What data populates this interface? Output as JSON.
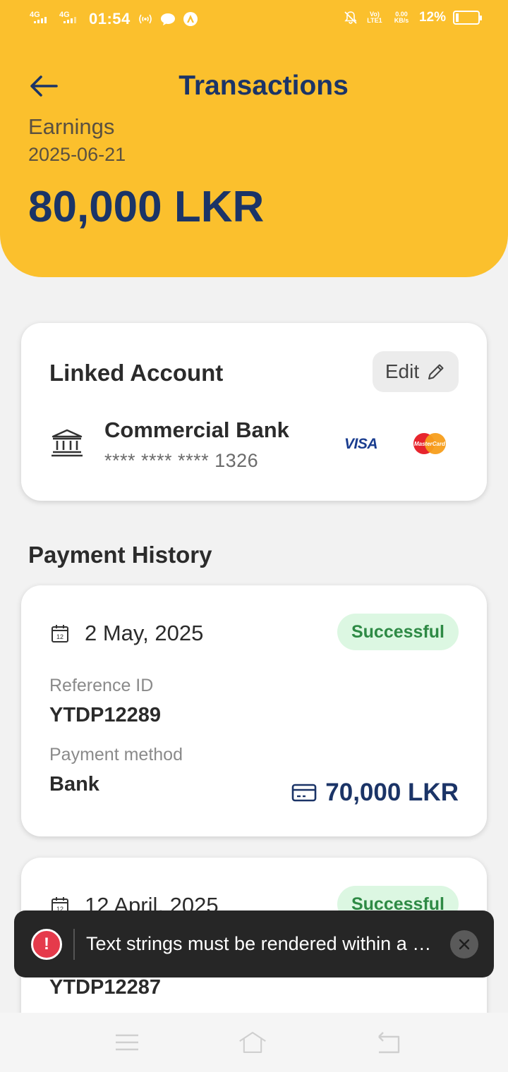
{
  "statusbar": {
    "net1": "4G",
    "net2": "4G",
    "time": "01:54",
    "volte": "Vo) LTE1",
    "speed": "0.00 KB/s",
    "battery": "12%"
  },
  "header": {
    "title": "Transactions",
    "earnings_label": "Earnings",
    "earnings_date": "2025-06-21",
    "earnings_amount": "80,000 LKR"
  },
  "linked_account": {
    "heading": "Linked Account",
    "edit_label": "Edit",
    "bank_name": "Commercial Bank",
    "card_number": "**** **** **** 1326",
    "visa_text": "VISA",
    "mastercard_text": "MasterCard"
  },
  "payment_history": {
    "title": "Payment History",
    "items": [
      {
        "date": "2 May, 2025",
        "calendar_day": "12",
        "status": "Successful",
        "ref_label": "Reference ID",
        "ref_value": "YTDP12289",
        "method_label": "Payment method",
        "method_value": "Bank",
        "amount": "70,000 LKR"
      },
      {
        "date": "12 April, 2025",
        "calendar_day": "12",
        "status": "Successful",
        "ref_value": "YTDP12287"
      }
    ]
  },
  "toast": {
    "message": "Text strings must be rendered within a …",
    "icon": "!"
  },
  "colors": {
    "header_bg": "#fbc02d",
    "accent_navy": "#1b3467",
    "success_bg": "#dcf7e2",
    "success_text": "#2e8a45",
    "toast_bg": "#262626",
    "error_red": "#e53a4b"
  }
}
